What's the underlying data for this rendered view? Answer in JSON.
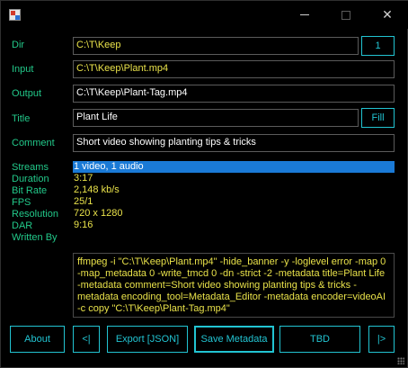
{
  "window": {
    "title": "",
    "controls": {
      "minimize": "—",
      "maximize": "",
      "close": "✕"
    }
  },
  "labels": {
    "dir": "Dir",
    "input": "Input",
    "output": "Output",
    "title": "Title",
    "comment": "Comment",
    "streams": "Streams",
    "duration": "Duration",
    "bitrate": "Bit Rate",
    "fps": "FPS",
    "resolution": "Resolution",
    "dar": "DAR",
    "written_by": "Written By"
  },
  "fields": {
    "dir": "C:\\T\\Keep",
    "input": "C:\\T\\Keep\\Plant.mp4",
    "output": "C:\\T\\Keep\\Plant-Tag.mp4",
    "title": "Plant Life",
    "comment": "Short video showing planting tips & tricks"
  },
  "buttons": {
    "dir_count": "1",
    "fill": "Fill",
    "about": "About",
    "prev": "<|",
    "export_json": "Export [JSON]",
    "save_metadata": "Save Metadata",
    "tbd": "TBD",
    "next": "|>"
  },
  "info": {
    "streams": "1 video, 1 audio",
    "duration": "3:17",
    "bitrate": "2,148 kb/s",
    "fps": "25/1",
    "resolution": "720 x 1280",
    "dar": "9:16",
    "written_by": ""
  },
  "ffmpeg_command": "ffmpeg -i \"C:\\T\\Keep\\Plant.mp4\" -hide_banner -y -loglevel error -map 0 -map_metadata 0 -write_tmcd 0 -dn -strict -2 -metadata title=Plant Life -metadata comment=Short video showing planting tips & tricks -metadata encoding_tool=Metadata_Editor -metadata encoder=videoAI -c copy \"C:\\T\\Keep\\Plant-Tag.mp4\"",
  "colors": {
    "label": "#22c98a",
    "value": "#e9e24a",
    "accent": "#22c4d2",
    "selection": "#1a7ad6"
  }
}
